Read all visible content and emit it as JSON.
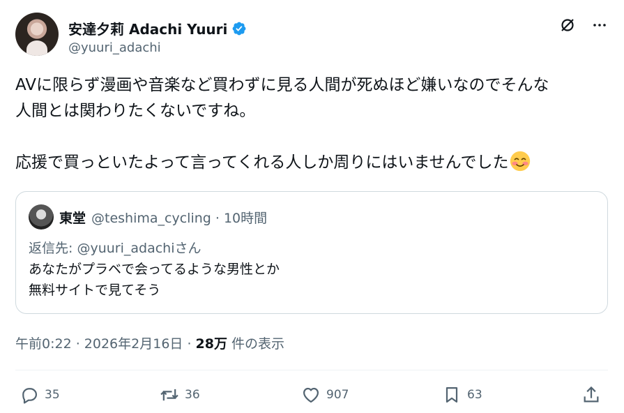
{
  "author": {
    "display_name": "安達夕莉 Adachi Yuuri",
    "handle": "@yuuri_adachi",
    "verified_color": "#1d9bf0"
  },
  "icons": [
    "grok-icon",
    "more-icon"
  ],
  "tweet": {
    "lines": [
      "AVに限らず漫画や音楽など買わずに見る人間が死ぬほど嫌いなのでそんな",
      "人間とは関わりたくないですね。",
      "応援で買っといたよって言ってくれる人しか周りにはいませんでした"
    ],
    "emoji": "smiling-face-with-blush-emoji"
  },
  "quote": {
    "name": "東堂",
    "handle_time": "@teshima_cycling · 10時間",
    "reply_prefix": "返信先: ",
    "reply_mention": "@yuuri_adachi",
    "reply_suffix": "さん",
    "body_lines": [
      "あなたがプラベで会ってるような男性とか",
      "無料サイトで見てそう"
    ]
  },
  "timestamp": {
    "time_date": "午前0:22 · 2026年2月16日 · ",
    "views_count": "28万",
    "views_label": " 件の表示"
  },
  "actions": {
    "replies": "35",
    "reposts": "36",
    "likes": "907",
    "bookmarks": "63"
  },
  "colors": {
    "text": "#0f1419",
    "secondary": "#536471",
    "border": "#cfd9de",
    "accent": "#1d9bf0"
  }
}
